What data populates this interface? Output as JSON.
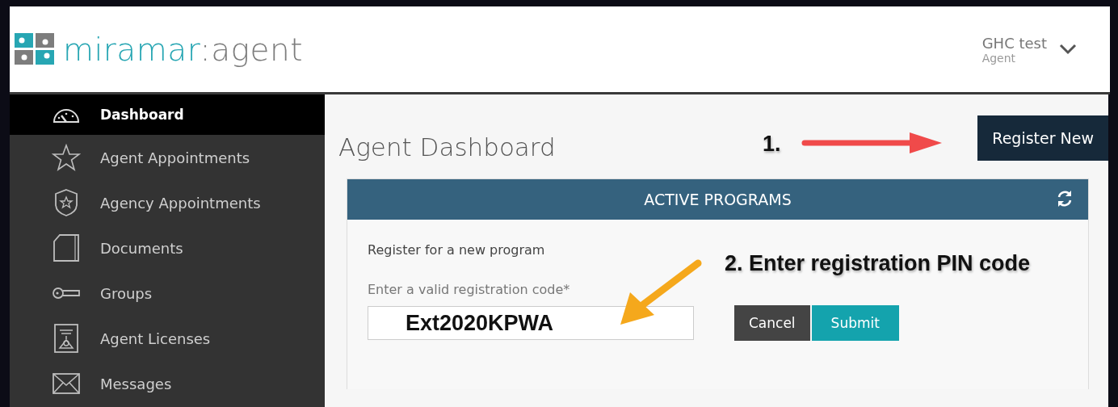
{
  "header": {
    "logo": {
      "brand": "miramar",
      "separator": ":",
      "product": "agent"
    },
    "user": {
      "name": "GHC test",
      "role": "Agent"
    }
  },
  "sidebar": {
    "items": [
      {
        "label": "Dashboard",
        "kind": "gauge",
        "selected": true
      },
      {
        "label": "Agent Appointments",
        "kind": "star",
        "selected": false
      },
      {
        "label": "Agency Appointments",
        "kind": "shield",
        "selected": false
      },
      {
        "label": "Documents",
        "kind": "document",
        "selected": false
      },
      {
        "label": "Groups",
        "kind": "key",
        "selected": false
      },
      {
        "label": "Agent Licenses",
        "kind": "license",
        "selected": false
      },
      {
        "label": "Messages",
        "kind": "envelope",
        "selected": false
      }
    ]
  },
  "main": {
    "title": "Agent Dashboard",
    "register_button": "Register New",
    "panel": {
      "title": "ACTIVE PROGRAMS",
      "form_title": "Register for a new program",
      "field": {
        "label": "Enter a valid registration code*",
        "value": "Ext2020KPWA"
      },
      "buttons": [
        {
          "label": "Cancel",
          "kind": "secondary"
        },
        {
          "label": "Submit",
          "kind": "primary"
        }
      ]
    }
  },
  "annotations": [
    {
      "text": "1.",
      "kind": "right",
      "color": "#f04a4a"
    },
    {
      "text": "2. Enter registration PIN code",
      "kind": "down-left",
      "color": "#f5a81c"
    }
  ]
}
